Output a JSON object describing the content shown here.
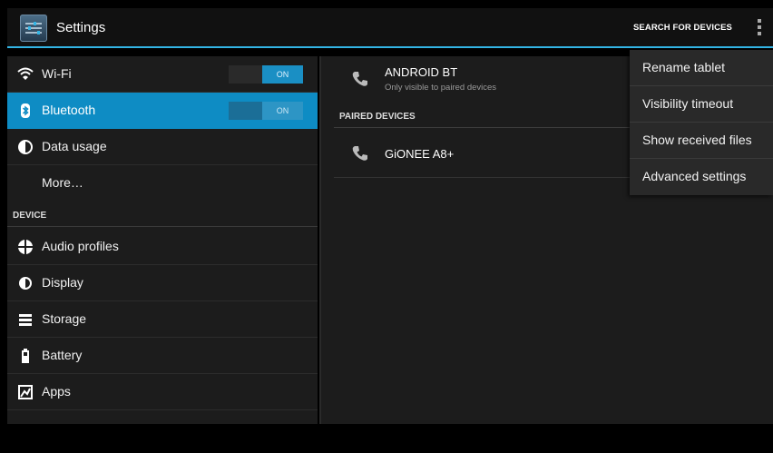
{
  "actionbar": {
    "title": "Settings",
    "search_label": "SEARCH FOR DEVICES"
  },
  "sidebar": {
    "items": [
      {
        "label": "Wi-Fi",
        "icon": "wifi-icon",
        "toggle": "ON"
      },
      {
        "label": "Bluetooth",
        "icon": "bluetooth-icon",
        "toggle": "ON",
        "selected": true
      },
      {
        "label": "Data usage",
        "icon": "data-usage-icon"
      },
      {
        "label": "More…"
      },
      {
        "section": "DEVICE"
      },
      {
        "label": "Audio profiles",
        "icon": "audio-profiles-icon"
      },
      {
        "label": "Display",
        "icon": "display-icon"
      },
      {
        "label": "Storage",
        "icon": "storage-icon"
      },
      {
        "label": "Battery",
        "icon": "battery-icon"
      },
      {
        "label": "Apps",
        "icon": "apps-icon"
      }
    ]
  },
  "bluetooth": {
    "device_name": "ANDROID BT",
    "device_sub": "Only visible to paired devices",
    "paired_header": "PAIRED DEVICES",
    "paired": [
      {
        "name": "GiONEE A8+"
      }
    ]
  },
  "menu": {
    "items": [
      "Rename tablet",
      "Visibility timeout",
      "Show received files",
      "Advanced settings"
    ]
  },
  "colors": {
    "accent": "#33b5e5",
    "selected_row": "#0e8cc4"
  }
}
